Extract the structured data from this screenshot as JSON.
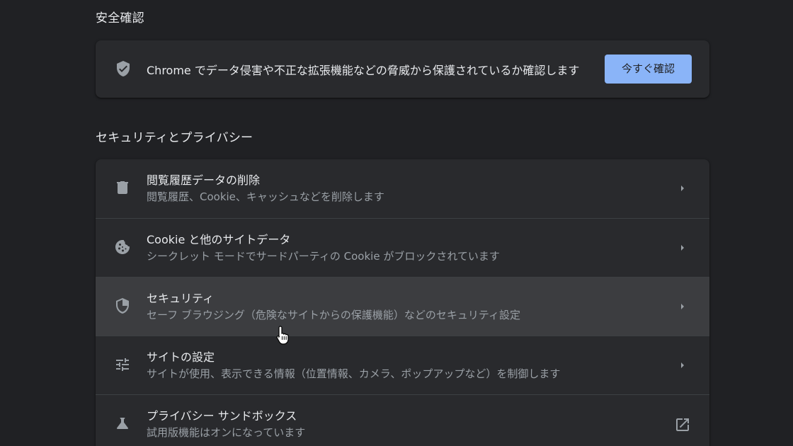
{
  "safety_check": {
    "title": "安全確認",
    "description": "Chrome でデータ侵害や不正な拡張機能などの脅威から保護されているか確認します",
    "button_label": "今すぐ確認",
    "icon": "shield-check-icon"
  },
  "privacy": {
    "title": "セキュリティとプライバシー",
    "items": [
      {
        "icon": "trash-icon",
        "label": "閲覧履歴データの削除",
        "sub": "閲覧履歴、Cookie、キャッシュなどを削除します",
        "action": "chevron-right-icon"
      },
      {
        "icon": "cookie-icon",
        "label": "Cookie と他のサイトデータ",
        "sub": "シークレット モードでサードパーティの Cookie がブロックされています",
        "action": "chevron-right-icon"
      },
      {
        "icon": "security-shield-icon",
        "label": "セキュリティ",
        "sub": "セーフ ブラウジング（危険なサイトからの保護機能）などのセキュリティ設定",
        "action": "chevron-right-icon"
      },
      {
        "icon": "tune-icon",
        "label": "サイトの設定",
        "sub": "サイトが使用、表示できる情報（位置情報、カメラ、ポップアップなど）を制御します",
        "action": "chevron-right-icon"
      },
      {
        "icon": "flask-icon",
        "label": "プライバシー サンドボックス",
        "sub": "試用版機能はオンになっています",
        "action": "open-in-new-icon"
      }
    ]
  },
  "colors": {
    "background": "#202124",
    "card": "#292a2d",
    "primary_text": "#e8eaed",
    "secondary_text": "#9aa0a6",
    "accent_button": "#8ab4f8",
    "hover_row": "#3c3d40"
  }
}
